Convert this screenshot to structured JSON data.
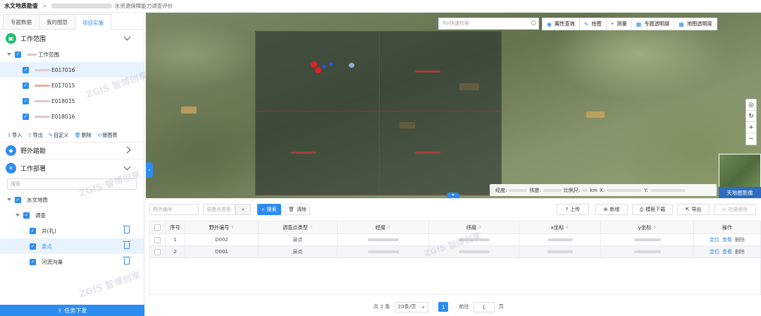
{
  "breadcrumb": {
    "app": "水文地质勘查",
    "separator": ">",
    "current": "水资源保障能力调查评价"
  },
  "sidebar": {
    "tabs": [
      {
        "label": "专题数据",
        "active": false
      },
      {
        "label": "我的图层",
        "active": false
      },
      {
        "label": "项目实施",
        "active": true
      }
    ],
    "work_scope": {
      "title": "工作范围",
      "root_label": "工作范围",
      "items": [
        {
          "label": "E017016",
          "selected": true
        },
        {
          "label": "E017015",
          "selected": false
        },
        {
          "label": "E018015",
          "selected": false
        },
        {
          "label": "E018016",
          "selected": false
        }
      ],
      "tools": [
        "导入",
        "导出",
        "自定义",
        "删除",
        "接图表"
      ]
    },
    "field_survey": {
      "title": "野外踏勘"
    },
    "work_deploy": {
      "title": "工作部署",
      "search_placeholder": "搜索",
      "tree": [
        {
          "label": "水文地质",
          "level": 0
        },
        {
          "label": "调查",
          "level": 1
        },
        {
          "label": "井(孔)",
          "level": 2
        },
        {
          "label": "泉点",
          "level": 2,
          "selected": true
        },
        {
          "label": "河流沟渠",
          "level": 2
        }
      ]
    },
    "dispatch_button": "任务下发"
  },
  "map": {
    "poi_placeholder": "Poi快速检索",
    "tools": [
      "属性查询",
      "绘图",
      "测量",
      "专题透明度",
      "地图透明度"
    ],
    "coords": {
      "lng_label": "经度:",
      "lat_label": "纬度:",
      "scale_label": "比例尺:",
      "scale_unit": "km",
      "x_label": "X:",
      "y_label": "Y:"
    },
    "basemap_label": "天地图影像",
    "zoom": [
      "◎",
      "↻",
      "+",
      "−"
    ]
  },
  "query": {
    "field_no_placeholder": "野外编号",
    "point_type_placeholder": "调查点类型",
    "search_label": "搜索",
    "clear_label": "清除",
    "actions": [
      "上传",
      "新增",
      "模板下载",
      "导出",
      "批量删除"
    ]
  },
  "table": {
    "columns": [
      "序号",
      "野外编号",
      "调查点类型",
      "经度",
      "纬度",
      "x坐标",
      "y坐标",
      "操作"
    ],
    "rows": [
      {
        "index": "1",
        "field_no": "D002",
        "type": "泉点"
      },
      {
        "index": "2",
        "field_no": "D001",
        "type": "泉点"
      }
    ],
    "row_actions": [
      "定位",
      "查看",
      "删除"
    ]
  },
  "pager": {
    "total": "共 2 条",
    "page_size": "20条/页",
    "current": "1",
    "goto_label": "前往",
    "goto_value": "1",
    "page_unit": "页"
  },
  "watermark": "ZGIS 智博创享",
  "colors": {
    "primary": "#2d8cf0",
    "green_icon": "#19be6b"
  }
}
